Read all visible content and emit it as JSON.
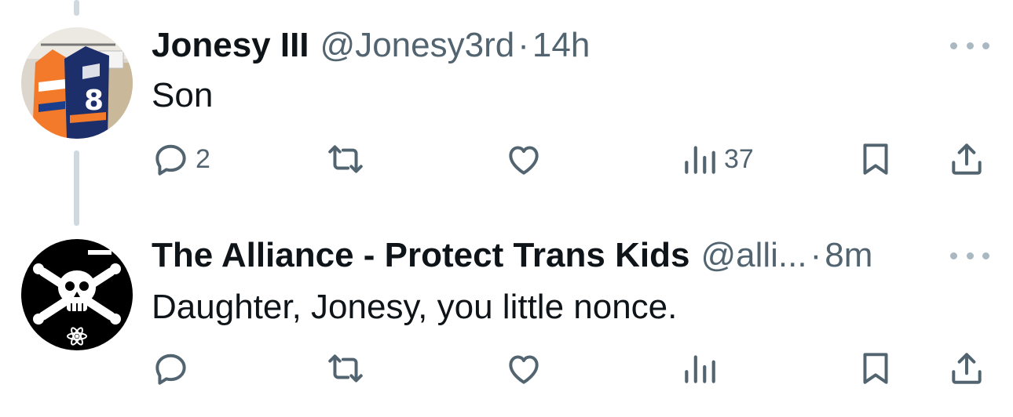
{
  "tweets": [
    {
      "display_name": "Jonesy III",
      "handle": "@Jonesy3rd",
      "separator": "·",
      "time": "14h",
      "text": "Son",
      "replies": "2",
      "retweets": "",
      "likes": "",
      "views": "37",
      "avatar": "jerseys-photo-avatar"
    },
    {
      "display_name": "The Alliance - Protect Trans Kids",
      "handle": "@alli...",
      "separator": "·",
      "time": "8m",
      "text": "Daughter, Jonesy, you little nonce.",
      "replies": "",
      "retweets": "",
      "likes": "",
      "views": "",
      "avatar": "skull-crossbones-avatar"
    }
  ],
  "colors": {
    "text": "#0f1419",
    "secondary": "#536471",
    "thread_line": "#cfd9de",
    "background": "#ffffff"
  }
}
